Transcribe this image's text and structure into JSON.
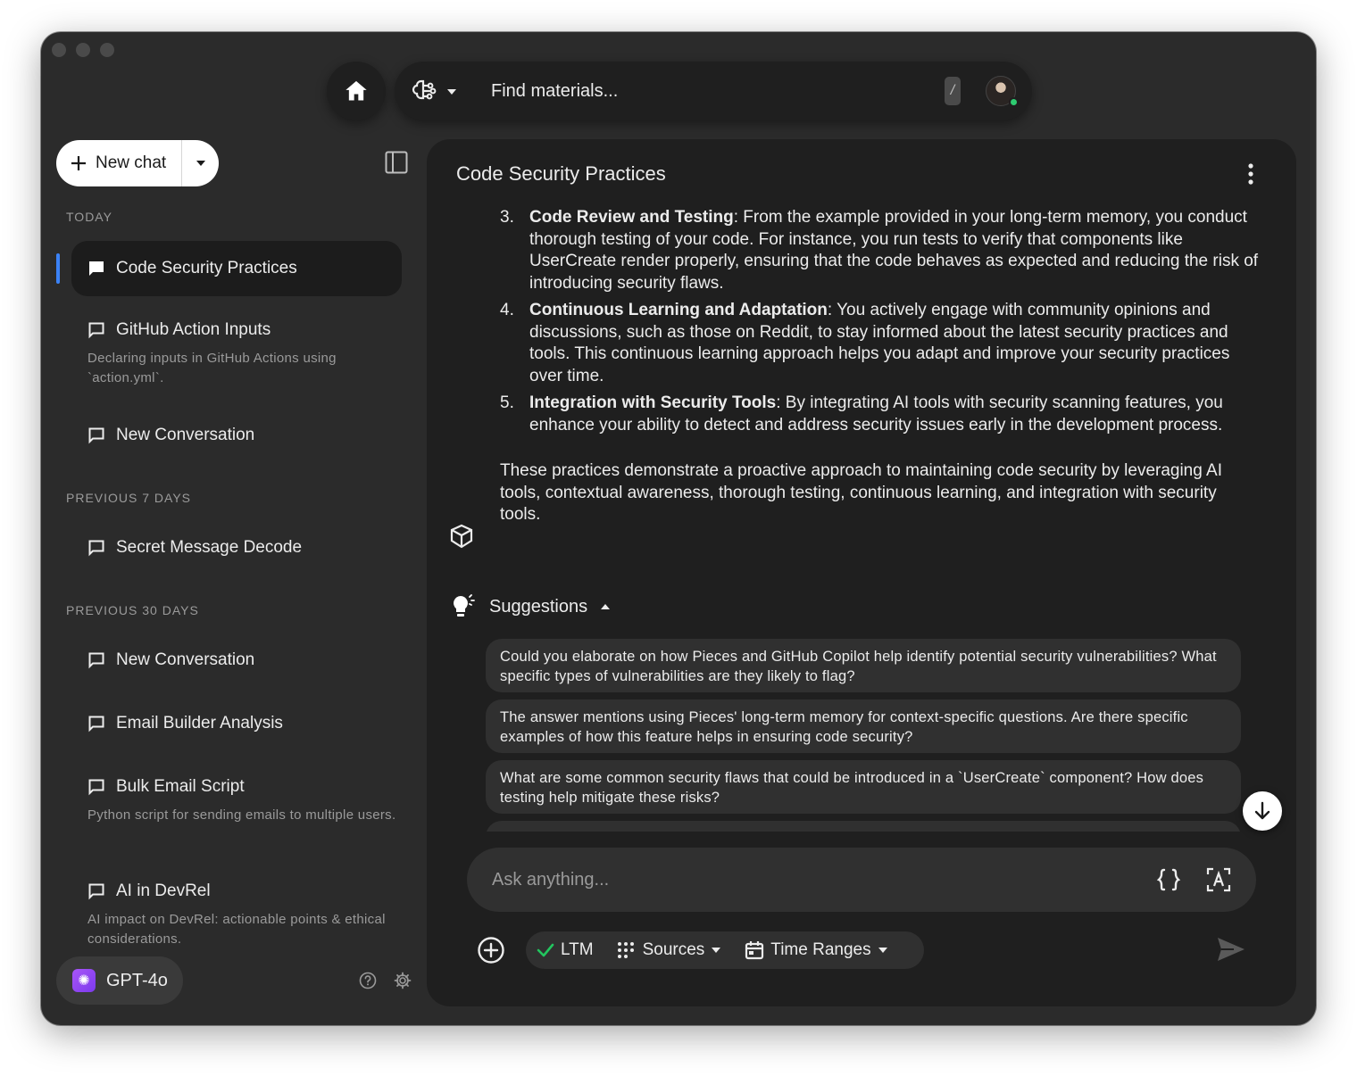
{
  "header": {
    "search_placeholder": "Find materials...",
    "shortcut_key": "/"
  },
  "sidebar": {
    "new_chat_label": "New chat",
    "sections": {
      "today": "TODAY",
      "previous_7": "PREVIOUS 7 DAYS",
      "previous_30": "PREVIOUS 30 DAYS"
    },
    "items": [
      {
        "title": "Code Security Practices",
        "subtitle": ""
      },
      {
        "title": "GitHub Action Inputs",
        "subtitle": "Declaring inputs in GitHub Actions using `action.yml`."
      },
      {
        "title": "New Conversation",
        "subtitle": ""
      },
      {
        "title": "Secret Message Decode",
        "subtitle": ""
      },
      {
        "title": "New Conversation",
        "subtitle": ""
      },
      {
        "title": "Email Builder Analysis",
        "subtitle": ""
      },
      {
        "title": "Bulk Email Script",
        "subtitle": "Python script for sending emails to multiple users."
      },
      {
        "title": "AI in DevRel",
        "subtitle": "AI impact on DevRel: actionable points & ethical considerations."
      }
    ],
    "model_label": "GPT-4o"
  },
  "main": {
    "title": "Code Security Practices",
    "points": [
      {
        "num": "3.",
        "heading": "Code Review and Testing",
        "text": ": From the example provided in your long-term memory, you conduct thorough testing of your code. For instance, you run tests to verify that components like UserCreate render properly, ensuring that the code behaves as expected and reducing the risk of introducing security flaws."
      },
      {
        "num": "4.",
        "heading": "Continuous Learning and Adaptation",
        "text": ": You actively engage with community opinions and discussions, such as those on Reddit, to stay informed about the latest security practices and tools. This continuous learning approach helps you adapt and improve your security practices over time."
      },
      {
        "num": "5.",
        "heading": "Integration with Security Tools",
        "text": ": By integrating AI tools with security scanning features, you enhance your ability to detect and address security issues early in the development process."
      }
    ],
    "summary": "These practices demonstrate a proactive approach to maintaining code security by leveraging AI tools, contextual awareness, thorough testing, continuous learning, and integration with security tools.",
    "suggestions_label": "Suggestions",
    "suggestions": [
      "Could you elaborate on how Pieces and GitHub Copilot help identify potential security vulnerabilities? What specific types of vulnerabilities are they likely to flag?",
      "The answer mentions using Pieces' long-term memory for context-specific questions. Are there specific examples of how this feature helps in ensuring code security?",
      "What are some common security flaws that could be introduced in a `UserCreate` component? How does testing help mitigate these risks?"
    ],
    "ask_placeholder": "Ask anything...",
    "tools": {
      "ltm": "LTM",
      "sources": "Sources",
      "time_ranges": "Time Ranges"
    }
  },
  "colors": {
    "accent_blue": "#3b82f6",
    "ltm_check": "#22c55e",
    "online": "#2ecc71"
  }
}
